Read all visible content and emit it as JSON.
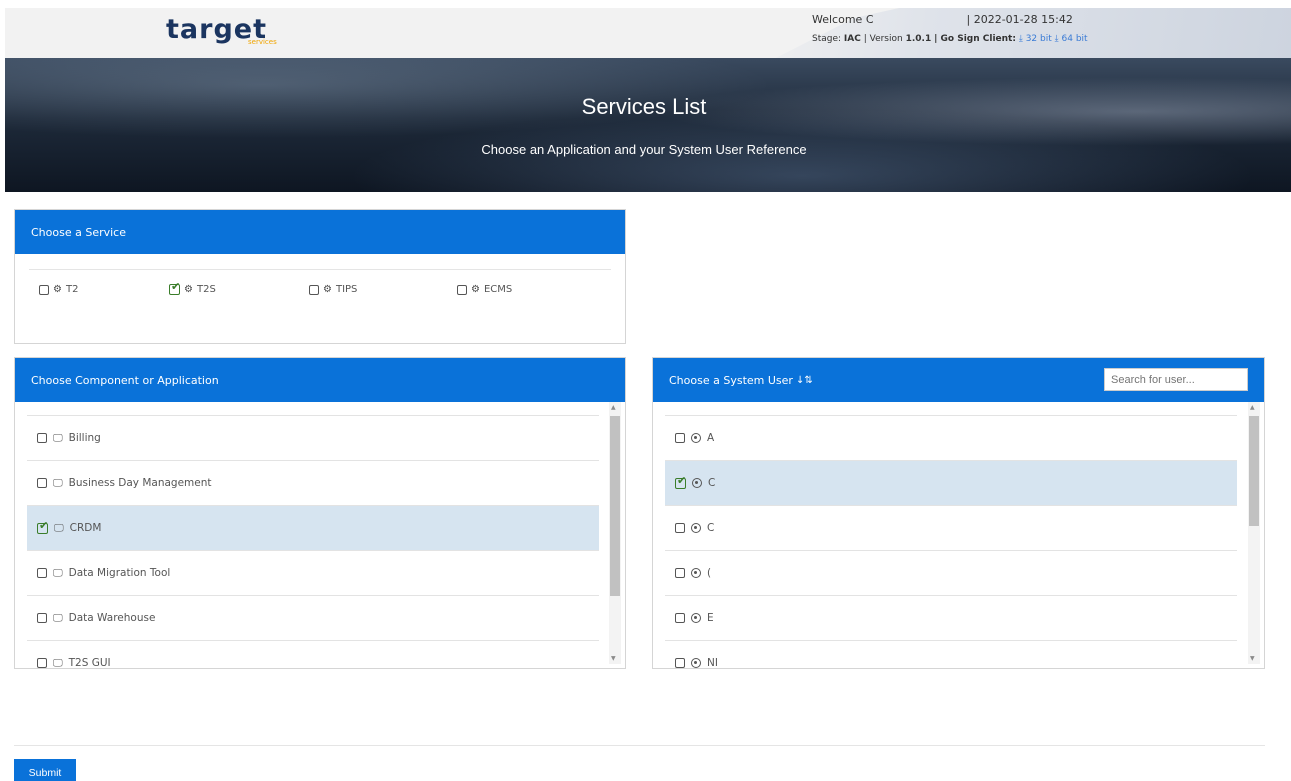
{
  "header": {
    "logo_main": "target",
    "logo_sub": "services",
    "welcome": "Welcome C",
    "datetime": "| 2022-01-28 15:42",
    "stage_label": "Stage:",
    "stage_value": "IAC",
    "version_label": "| Version",
    "version_value": "1.0.1",
    "gosign_label": "| Go Sign Client:",
    "link_32": "32 bit",
    "link_64": "64 bit"
  },
  "banner": {
    "title": "Services List",
    "subtitle": "Choose an Application and your System User Reference"
  },
  "service_panel": {
    "title": "Choose a Service",
    "items": [
      {
        "label": "T2",
        "checked": false
      },
      {
        "label": "T2S",
        "checked": true
      },
      {
        "label": "TIPS",
        "checked": false
      },
      {
        "label": "ECMS",
        "checked": false
      }
    ]
  },
  "component_panel": {
    "title": "Choose Component or Application",
    "items": [
      {
        "label": "Billing",
        "checked": false
      },
      {
        "label": "Business Day Management",
        "checked": false
      },
      {
        "label": "CRDM",
        "checked": true
      },
      {
        "label": "Data Migration Tool",
        "checked": false
      },
      {
        "label": "Data Warehouse",
        "checked": false
      },
      {
        "label": "T2S GUI",
        "checked": false
      }
    ]
  },
  "user_panel": {
    "title": "Choose a System User",
    "search_placeholder": "Search for user...",
    "items": [
      {
        "label": "A",
        "checked": false
      },
      {
        "label": "C",
        "checked": true
      },
      {
        "label": "C",
        "checked": false
      },
      {
        "label": "(",
        "checked": false
      },
      {
        "label": "E",
        "checked": false
      },
      {
        "label": "NI",
        "checked": false
      }
    ]
  },
  "footer": {
    "submit_label": "Submit"
  },
  "colors": {
    "primary": "#0a72d9",
    "selected_row": "#d6e4f0",
    "check_green": "#3a7d2a",
    "logo": "#1b3560",
    "logo_accent": "#f0a500"
  }
}
